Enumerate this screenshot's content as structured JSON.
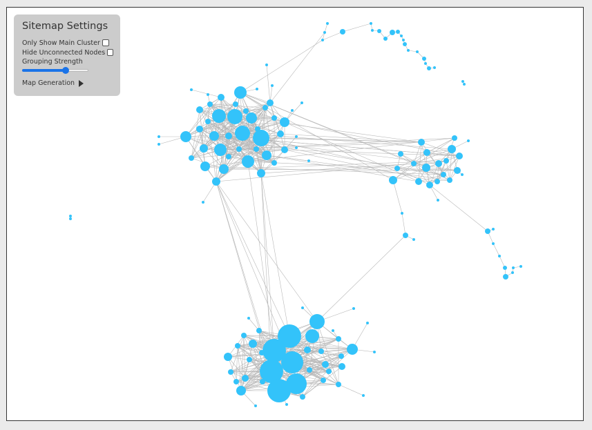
{
  "settings": {
    "title": "Sitemap Settings",
    "only_main_cluster_label": "Only Show Main Cluster",
    "only_main_cluster_checked": false,
    "hide_unconnected_label": "Hide Unconnected Nodes",
    "hide_unconnected_checked": false,
    "grouping_strength_label": "Grouping Strength",
    "grouping_strength_value": 0.66,
    "map_generation_label": "Map Generation",
    "map_generation_icon": "play-icon"
  },
  "colors": {
    "node": "#33c3fa",
    "edge": "#b7b7b7",
    "panel": "#cccccc",
    "slider_accent": "#1a73e8"
  }
}
